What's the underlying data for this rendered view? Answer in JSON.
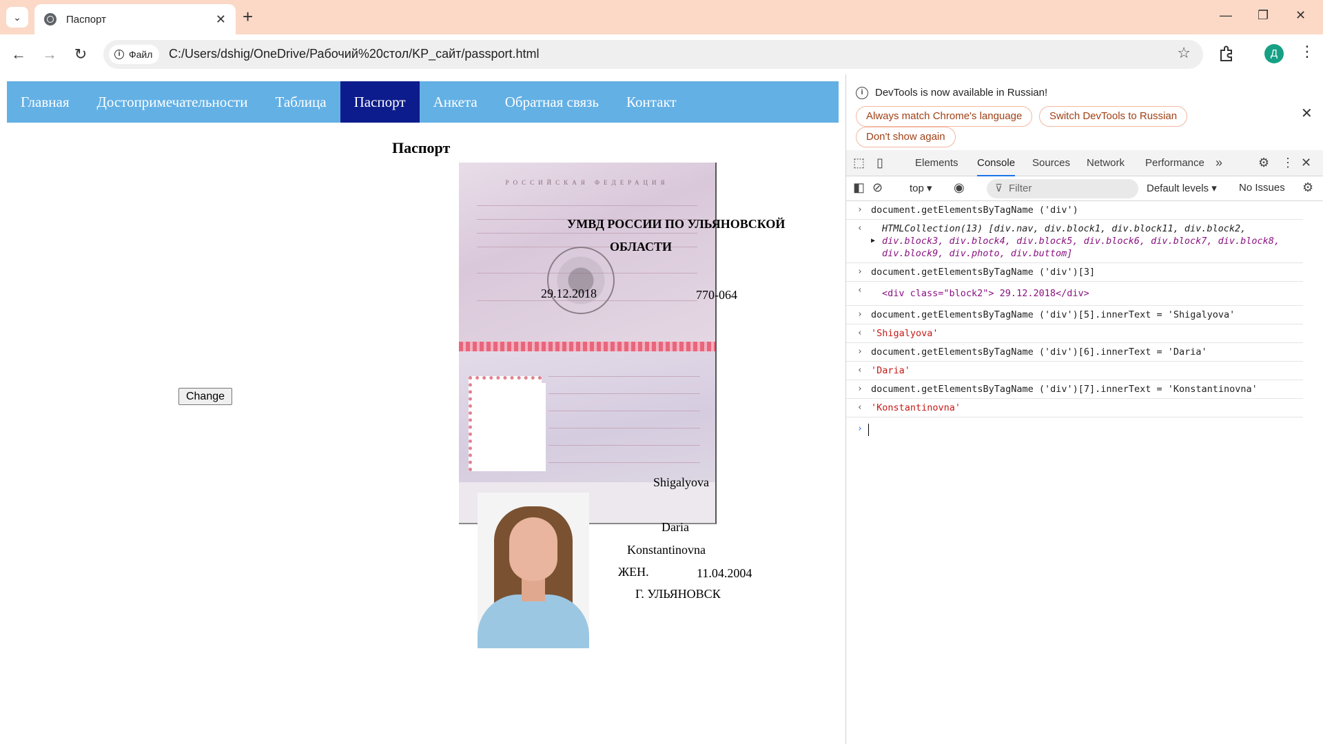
{
  "browser": {
    "tab_title": "Паспорт",
    "site_chip": "Файл",
    "url": "C:/Users/dshig/OneDrive/Рабочий%20стол/KP_сайт/passport.html",
    "profile_initial": "Д"
  },
  "site": {
    "nav": [
      "Главная",
      "Достопримечательности",
      "Таблица",
      "Паспорт",
      "Анкета",
      "Обратная связь",
      "Контакт"
    ],
    "active_nav": "Паспорт",
    "title": "Паспорт",
    "change_button": "Change",
    "passport": {
      "country_header": "РОССИЙСКАЯ ФЕДЕРАЦИЯ",
      "issued_by": "УМВД РОССИИ ПО УЛЬЯНОВСКОЙ",
      "issued_by_2": "ОБЛАСТИ",
      "issue_date": "29.12.2018",
      "department_code": "770-064",
      "surname": "Shigalyova",
      "name": "Daria",
      "patronymic": "Konstantinovna",
      "sex": "ЖЕН.",
      "birth_date": "11.04.2004",
      "birth_place": "Г. УЛЬЯНОВСК"
    }
  },
  "devtools": {
    "banner_text": "DevTools is now available in Russian!",
    "btn_match": "Always match Chrome's language",
    "btn_switch": "Switch DevTools to Russian",
    "btn_dont_show": "Don't show again",
    "tabs": [
      "Elements",
      "Console",
      "Sources",
      "Network",
      "Performance"
    ],
    "active_tab": "Console",
    "context": "top",
    "filter_placeholder": "Filter",
    "levels": "Default levels",
    "issues": "No Issues",
    "console": {
      "cmd1": "document.getElementsByTagName ('div')",
      "res1_head": "HTMLCollection(13) [div.nav, div.block1, div.block11, div.block2,",
      "res1_body": "div.block3, div.block4, div.block5, div.block6, div.block7, div.block8,",
      "res1_tail": "div.block9, div.photo, div.buttom]",
      "cmd2": "document.getElementsByTagName ('div')[3]",
      "res2": "<div class=\"block2\"> 29.12.2018</div>",
      "cmd3": "document.getElementsByTagName ('div')[5].innerText = 'Shigalyova'",
      "res3": "'Shigalyova'",
      "cmd4": "document.getElementsByTagName ('div')[6].innerText = 'Daria'",
      "res4": "'Daria'",
      "cmd5": "document.getElementsByTagName ('div')[7].innerText = 'Konstantinovna'",
      "res5": "'Konstantinovna'"
    }
  }
}
